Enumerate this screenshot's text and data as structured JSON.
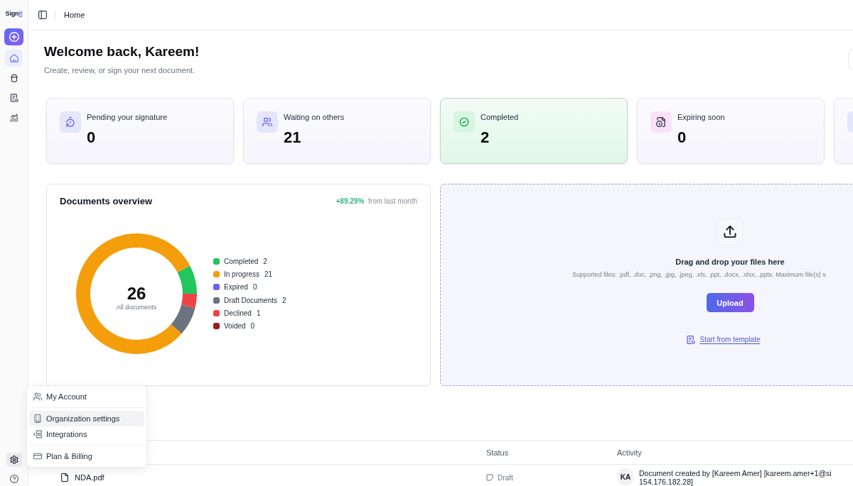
{
  "sidebar": {
    "logo": {
      "text": "Sign",
      "accent": "it"
    },
    "items": [
      {
        "kind": "home",
        "selected": true
      },
      {
        "kind": "jar",
        "selected": false
      },
      {
        "kind": "document",
        "selected": false
      },
      {
        "kind": "chart",
        "selected": false
      }
    ],
    "footer_items": [
      {
        "kind": "settings",
        "selected": true
      },
      {
        "kind": "help",
        "selected": false
      }
    ]
  },
  "header": {
    "breadcrumb": "Home"
  },
  "welcome": {
    "title": "Welcome back, Kareem!",
    "subtitle": "Create, review, or sign your next document."
  },
  "stats": [
    {
      "kind": "timer",
      "label": "Pending your signature",
      "value": "0",
      "color": "#e4e6fb",
      "selected": false
    },
    {
      "kind": "users",
      "label": "Waiting on others",
      "value": "21",
      "color": "#e4e6fb",
      "selected": false
    },
    {
      "kind": "check",
      "label": "Completed",
      "value": "2",
      "color": "#d8f5e2",
      "selected": true
    },
    {
      "kind": "file-clock",
      "label": "Expiring soon",
      "value": "0",
      "color": "#f8e2fa",
      "selected": false
    },
    {
      "kind": "other",
      "color": "#e4e6fb",
      "selected": false
    }
  ],
  "overview": {
    "title": "Documents overview",
    "change": "+89.29%",
    "change_note": "from last month",
    "total": "26",
    "total_label": "All documents",
    "legend": [
      {
        "value": "2",
        "color": "#22c55e"
      },
      {
        "value": "21",
        "color": "#f59e0b"
      },
      {
        "value": "0",
        "color": "#6366f1"
      },
      {
        "value": "2",
        "color": "#6b7280"
      },
      {
        "value": "1",
        "color": "#ef4444"
      },
      {
        "value": "0",
        "color": "#991b1b"
      }
    ],
    "chart_data": {
      "type": "donut",
      "categories": [
        "Completed",
        "In progress",
        "Expired",
        "Draft Documents",
        "Declined",
        "Voided"
      ],
      "values": [
        7.69,
        80.77,
        0,
        7.69,
        3.85,
        0
      ]
    }
  },
  "upload": {
    "title": "Drag and drop your files here",
    "supported": "Supported files: .pdf, .doc, .png, .jpg, .jpeg, .xls, .ppt, .docx, .xlsx, .pptx. Maximum file(s) s",
    "button": "Upload",
    "template_link": "Start from template"
  },
  "table": {
    "columns": [
      "Status",
      "Activity"
    ],
    "rows": [
      {
        "name": "NDA.pdf",
        "status": "Draft",
        "activity": {
          "initials": "KA",
          "lines": [
            "Document created by [Kareem Amer] [kareem.amer+1@si",
            "154.176.182.28]"
          ]
        }
      }
    ]
  },
  "menu": {
    "groups": [
      [
        {
          "kind": "account",
          "label": "My Account",
          "selected": false
        }
      ],
      [
        {
          "kind": "organization",
          "label": "Organization settings",
          "selected": true
        },
        {
          "kind": "integrations",
          "label": "Integrations",
          "selected": false
        }
      ],
      [
        {
          "kind": "billing",
          "label": "Plan & Billing",
          "selected": false
        }
      ]
    ]
  }
}
